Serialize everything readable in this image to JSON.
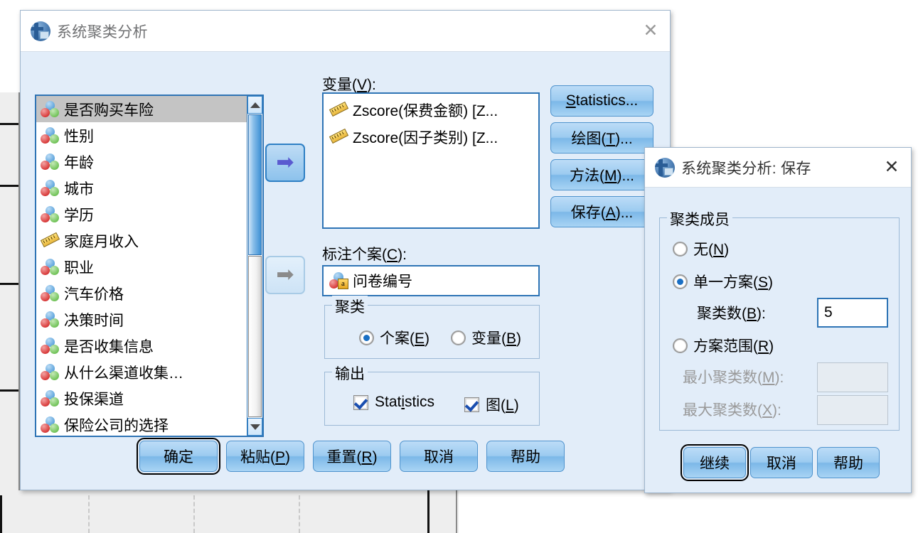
{
  "background": {
    "description": "spss-data-sheet"
  },
  "main_dialog": {
    "title": "系统聚类分析",
    "icon": "spss-icon",
    "close_label": "✕",
    "source_list": {
      "name": "source-variable-list",
      "items": [
        {
          "label": "是否购买车险",
          "icon": "nominal-icon",
          "selected": true
        },
        {
          "label": "性别",
          "icon": "nominal-icon",
          "selected": false
        },
        {
          "label": "年龄",
          "icon": "nominal-icon",
          "selected": false
        },
        {
          "label": "城市",
          "icon": "nominal-icon",
          "selected": false
        },
        {
          "label": "学历",
          "icon": "nominal-icon",
          "selected": false
        },
        {
          "label": "家庭月收入",
          "icon": "scale-icon",
          "selected": false
        },
        {
          "label": "职业",
          "icon": "nominal-icon",
          "selected": false
        },
        {
          "label": "汽车价格",
          "icon": "nominal-icon",
          "selected": false
        },
        {
          "label": "决策时间",
          "icon": "nominal-icon",
          "selected": false
        },
        {
          "label": "是否收集信息",
          "icon": "nominal-icon",
          "selected": false
        },
        {
          "label": "从什么渠道收集…",
          "icon": "nominal-icon",
          "selected": false
        },
        {
          "label": "投保渠道",
          "icon": "nominal-icon",
          "selected": false
        },
        {
          "label": "保险公司的选择",
          "icon": "nominal-icon",
          "selected": false
        }
      ]
    },
    "move_variables_arrow": "➡",
    "move_label_arrow": "➡",
    "variables": {
      "label_prefix": "变量(",
      "label_key": "V",
      "label_suffix": "):",
      "items": [
        {
          "label": "Zscore(保费金额) [Z...",
          "icon": "scale-icon"
        },
        {
          "label": "Zscore(因子类别) [Z...",
          "icon": "scale-icon"
        }
      ]
    },
    "label_cases": {
      "label_prefix": "标注个案(",
      "label_key": "C",
      "label_suffix": "):",
      "value": "问卷编号",
      "icon": "string-nominal-icon"
    },
    "cluster_group": {
      "title": "聚类",
      "options": [
        {
          "label_prefix": "个案(",
          "label_key": "E",
          "label_suffix": ")",
          "checked": true
        },
        {
          "label_prefix": "变量(",
          "label_key": "B",
          "label_suffix": ")",
          "checked": false
        }
      ]
    },
    "output_group": {
      "title": "输出",
      "options": [
        {
          "label_prefix": "Stat",
          "label_key": "i",
          "label_suffix": "stics",
          "checked": true
        },
        {
          "label_prefix": "图(",
          "label_key": "L",
          "label_suffix": ")",
          "checked": true
        }
      ]
    },
    "side_buttons": [
      {
        "name": "statistics-button",
        "prefix": "",
        "key": "S",
        "suffix": "tatistics..."
      },
      {
        "name": "plots-button",
        "prefix": "绘图(",
        "key": "T",
        "suffix": ")..."
      },
      {
        "name": "method-button",
        "prefix": "方法(",
        "key": "M",
        "suffix": ")..."
      },
      {
        "name": "save-button",
        "prefix": "保存(",
        "key": "A",
        "suffix": ")..."
      }
    ],
    "bottom_buttons": [
      {
        "name": "ok-button",
        "prefix": "确定",
        "key": "",
        "suffix": "",
        "focused": true
      },
      {
        "name": "paste-button",
        "prefix": "粘贴(",
        "key": "P",
        "suffix": ")",
        "focused": false
      },
      {
        "name": "reset-button",
        "prefix": "重置(",
        "key": "R",
        "suffix": ")",
        "focused": false
      },
      {
        "name": "cancel-button",
        "prefix": "取消",
        "key": "",
        "suffix": "",
        "focused": false
      },
      {
        "name": "help-button",
        "prefix": "帮助",
        "key": "",
        "suffix": "",
        "focused": false
      }
    ]
  },
  "save_dialog": {
    "title": "系统聚类分析: 保存",
    "icon": "spss-icon",
    "close_label": "✕",
    "cluster_membership": {
      "title": "聚类成员",
      "options": [
        {
          "name": "none-radio",
          "prefix": "无(",
          "key": "N",
          "suffix": ")",
          "checked": false,
          "disabled": false
        },
        {
          "name": "single-solution-radio",
          "prefix": "单一方案(",
          "key": "S",
          "suffix": ")",
          "checked": true,
          "disabled": false
        },
        {
          "name": "range-of-solutions-radio",
          "prefix": "方案范围(",
          "key": "R",
          "suffix": ")",
          "checked": false,
          "disabled": false
        }
      ],
      "number_of_clusters": {
        "prefix": "聚类数(",
        "key": "B",
        "suffix": "):",
        "value": "5",
        "disabled": false
      },
      "minimum_clusters": {
        "prefix": "最小聚类数(",
        "key": "M",
        "suffix": "):",
        "value": "",
        "disabled": true
      },
      "maximum_clusters": {
        "prefix": "最大聚类数(",
        "key": "X",
        "suffix": "):",
        "value": "",
        "disabled": true
      }
    },
    "bottom_buttons": [
      {
        "name": "continue-button",
        "label": "继续",
        "focused": true
      },
      {
        "name": "cancel-button",
        "label": "取消",
        "focused": false
      },
      {
        "name": "help-button",
        "label": "帮助",
        "focused": false
      }
    ]
  },
  "colors": {
    "dialog_body": "#e2edf9",
    "accent_border": "#2e74b5",
    "title_text": "#6f7072",
    "selection": "#c4c4c4"
  }
}
